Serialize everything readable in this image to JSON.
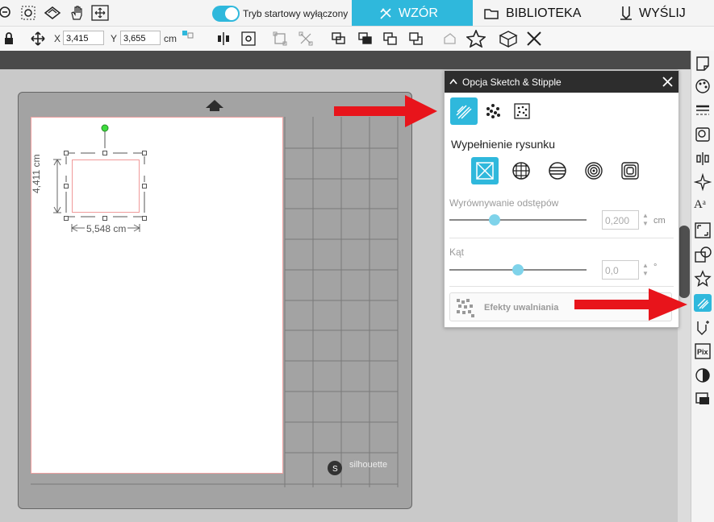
{
  "topbar": {
    "toggle_label": "Tryb startowy wyłączony",
    "tabs": [
      {
        "label": "WZÓR",
        "icon": "design-icon",
        "active": true
      },
      {
        "label": "BIBLIOTEKA",
        "icon": "folder-icon",
        "active": false
      },
      {
        "label": "WYŚLIJ",
        "icon": "send-icon",
        "active": false
      }
    ]
  },
  "toolbar": {
    "x_label": "X",
    "x_value": "3,415",
    "y_label": "Y",
    "y_value": "3,655",
    "unit": "cm"
  },
  "panel": {
    "title": "Opcja Sketch & Stipple",
    "fill_section_label": "Wypełnienie rysunku",
    "spacing_label": "Wyrównywanie odstępów",
    "spacing_value": "0,200",
    "spacing_unit": "cm",
    "spacing_level": 0.33,
    "angle_label": "Kąt",
    "angle_value": "0,0",
    "angle_unit": "°",
    "angle_level": 0.5,
    "effects_button_label": "Efekty uwalniania"
  },
  "canvas": {
    "height_dim": "4,411 cm",
    "width_dim": "5,548 cm",
    "brand_label": "silhouette"
  },
  "colors": {
    "accent": "#2fb8dc",
    "arrow": "#e8141b",
    "panel_header": "#2d2d2d",
    "selection": "#f09a9a"
  }
}
